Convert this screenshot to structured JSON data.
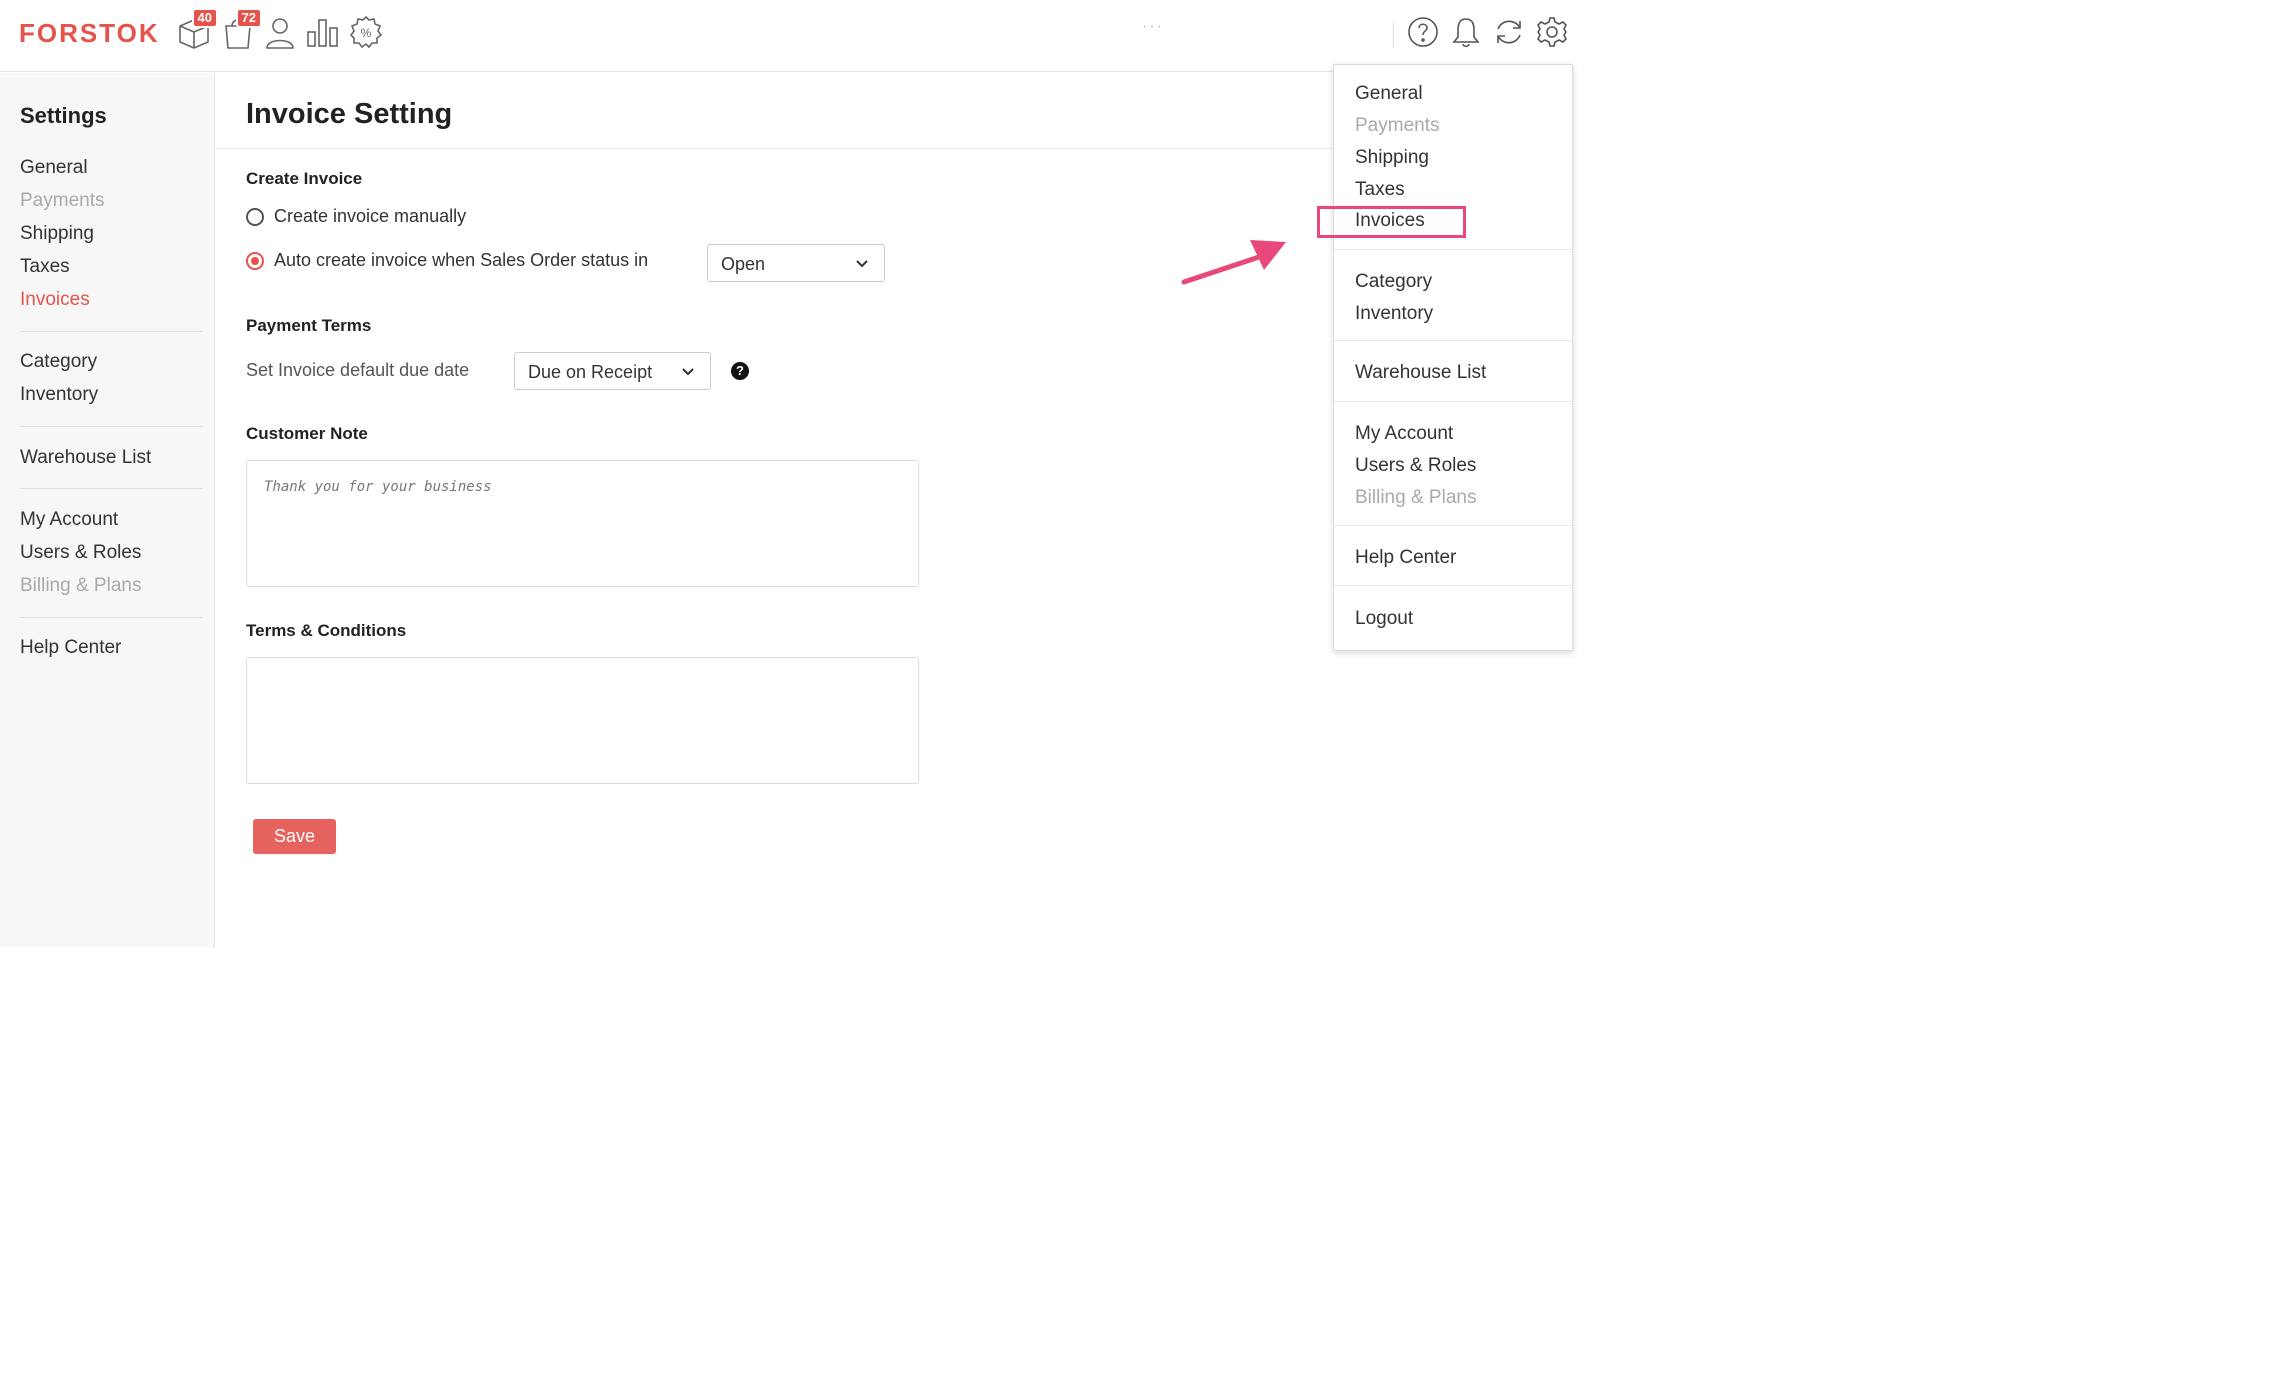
{
  "brand": {
    "logo": "FORSTOK",
    "accent": "#e5534b"
  },
  "topnav": {
    "items": [
      {
        "icon": "package-icon",
        "badge": "40"
      },
      {
        "icon": "shopping-bag-icon",
        "badge": "72"
      },
      {
        "icon": "user-icon"
      },
      {
        "icon": "bar-chart-icon"
      },
      {
        "icon": "discount-badge-icon"
      }
    ],
    "ellipsis": "···",
    "right_icons": [
      "help-circle-icon",
      "bell-icon",
      "sync-icon",
      "gear-icon"
    ]
  },
  "sidebar": {
    "title": "Settings",
    "groups": [
      [
        "General",
        "Payments",
        "Shipping",
        "Taxes",
        "Invoices"
      ],
      [
        "Category",
        "Inventory"
      ],
      [
        "Warehouse List"
      ],
      [
        "My Account",
        "Users & Roles",
        "Billing & Plans"
      ],
      [
        "Help Center"
      ]
    ],
    "active": "Invoices"
  },
  "main": {
    "title": "Invoice Setting",
    "create_invoice": {
      "label": "Create Invoice",
      "option_manual": "Create invoice manually",
      "option_auto": "Auto create invoice when Sales Order status in",
      "selected": "auto",
      "status_value": "Open"
    },
    "payment_terms": {
      "label": "Payment Terms",
      "due_date_label": "Set Invoice default due date",
      "due_date_value": "Due on Receipt",
      "help": "?"
    },
    "customer_note": {
      "label": "Customer Note",
      "placeholder": "Thank you for your business"
    },
    "terms": {
      "label": "Terms & Conditions",
      "value": ""
    },
    "save_label": "Save"
  },
  "dropdown": {
    "items": [
      "General",
      "Payments",
      "Shipping",
      "Taxes",
      "Invoices",
      "Category",
      "Inventory",
      "Warehouse List",
      "My Account",
      "Users & Roles",
      "Billing & Plans",
      "Help Center",
      "Logout"
    ],
    "highlighted": "Invoices",
    "highlight_color": "#e8487a"
  }
}
